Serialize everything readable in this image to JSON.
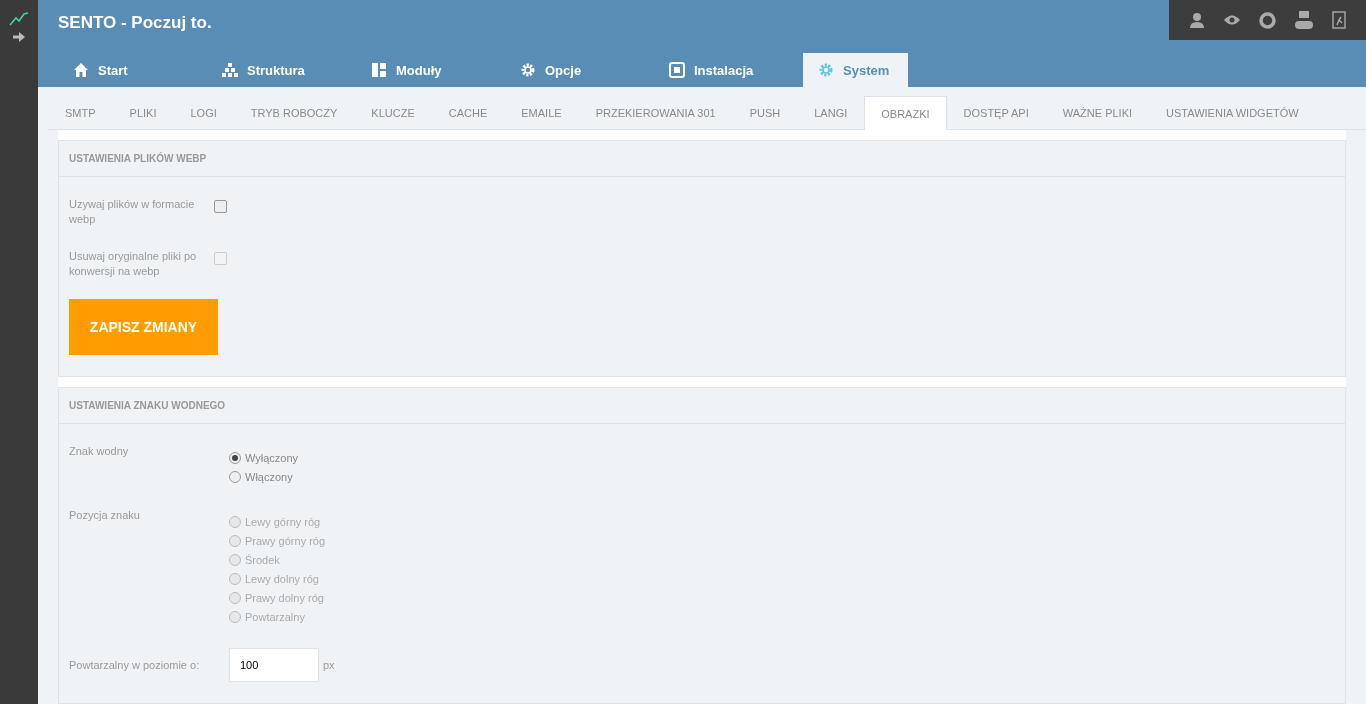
{
  "header": {
    "title": "SENTO - Poczuj to."
  },
  "main_tabs": [
    {
      "label": "Start",
      "selected": false
    },
    {
      "label": "Struktura",
      "selected": false
    },
    {
      "label": "Moduły",
      "selected": false
    },
    {
      "label": "Opcje",
      "selected": false
    },
    {
      "label": "Instalacja",
      "selected": false
    },
    {
      "label": "System",
      "selected": true
    }
  ],
  "sub_tabs": [
    {
      "label": "SMTP",
      "selected": false
    },
    {
      "label": "PLIKI",
      "selected": false
    },
    {
      "label": "LOGI",
      "selected": false
    },
    {
      "label": "TRYB ROBOCZY",
      "selected": false
    },
    {
      "label": "KLUCZE",
      "selected": false
    },
    {
      "label": "CACHE",
      "selected": false
    },
    {
      "label": "EMAILE",
      "selected": false
    },
    {
      "label": "PRZEKIEROWANIA 301",
      "selected": false
    },
    {
      "label": "PUSH",
      "selected": false
    },
    {
      "label": "LANGI",
      "selected": false
    },
    {
      "label": "OBRAZKI",
      "selected": true
    },
    {
      "label": "DOSTĘP API",
      "selected": false
    },
    {
      "label": "WAŻNE PLIKI",
      "selected": false
    },
    {
      "label": "USTAWIENIA WIDGETÓW",
      "selected": false
    }
  ],
  "panels": [
    {
      "title": "USTAWIENIA PLIKÓW WEBP",
      "rows": [
        {
          "kind": "checkbox",
          "label": "Uzywaj plików w formacie webp",
          "checked": false,
          "disabled": false
        },
        {
          "kind": "checkbox",
          "label": "Usuwaj oryginalne pliki po konwersji na webp",
          "checked": false,
          "disabled": true
        },
        {
          "kind": "button",
          "label": "ZAPISZ ZMIANY"
        }
      ]
    },
    {
      "title": "USTAWIENIA ZNAKU WODNEGO",
      "rows": [
        {
          "kind": "radio",
          "label": "Znak wodny",
          "options": [
            {
              "label": "Wyłączony",
              "selected": true,
              "disabled": false
            },
            {
              "label": "Włączony",
              "selected": false,
              "disabled": false
            }
          ]
        },
        {
          "kind": "radio",
          "label": "Pozycja znaku",
          "options": [
            {
              "label": "Lewy górny róg",
              "selected": false,
              "disabled": true
            },
            {
              "label": "Prawy górny róg",
              "selected": false,
              "disabled": true
            },
            {
              "label": "Środek",
              "selected": false,
              "disabled": true
            },
            {
              "label": "Lewy dolny róg",
              "selected": false,
              "disabled": true
            },
            {
              "label": "Prawy dolny róg",
              "selected": false,
              "disabled": true
            },
            {
              "label": "Powtarzalny",
              "selected": false,
              "disabled": true
            }
          ]
        },
        {
          "kind": "input",
          "label": "Powtarzalny w poziomie o:",
          "value": "100",
          "unit": "px"
        }
      ]
    }
  ]
}
